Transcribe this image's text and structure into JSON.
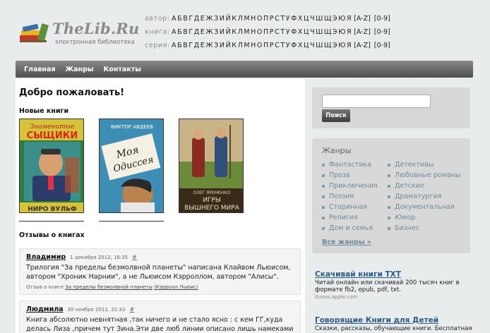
{
  "site": {
    "title": "TheLib.Ru",
    "subtitle": "электронная библиотека"
  },
  "alphabet": {
    "rows": [
      {
        "label": "автор:"
      },
      {
        "label": "книга:"
      },
      {
        "label": "серия:"
      }
    ],
    "letters": [
      "А",
      "Б",
      "В",
      "Г",
      "Д",
      "Е",
      "Ж",
      "З",
      "И",
      "Й",
      "К",
      "Л",
      "М",
      "Н",
      "О",
      "П",
      "Р",
      "С",
      "Т",
      "У",
      "Ф",
      "Х",
      "Ц",
      "Ч",
      "Ш",
      "Щ",
      "Э",
      "Ю",
      "Я"
    ],
    "latin": "[A-Z]",
    "digits": "[0-9]"
  },
  "nav": {
    "items": [
      "Главная",
      "Жанры",
      "Контакты"
    ]
  },
  "main": {
    "welcome": "Добро пожаловать!",
    "new_books_heading": "Новые книги",
    "books": [
      {
        "title": "ЗНАМЕНИТЫЕ СЫЩИКИ",
        "author": "НИРО ВУЛЬФ"
      },
      {
        "title": "Моя Одиссея",
        "author": "ВИКТОР АВДЕЕВ"
      },
      {
        "title": "ИГРЫ ВЫШНЕГО МИРА",
        "author": "ОЛЕГ ЯРЕМЕНКО"
      }
    ],
    "reviews_heading": "Отзывы о книгах",
    "reviews": [
      {
        "author": "Владимир",
        "date": "1 декабря 2012, 16:35",
        "hash": "#",
        "text": "Трилогия \"За пределы безмолвной планеты\" написана Клайвом Льюисом, автором \"Хроник Нарнии\", а не Льюисом Кэрроллом, автором \"Алисы\".",
        "meta_prefix": "Отзыв о книге",
        "book_link": "За пределы безмолвной планеты",
        "book_author": "(Кэрролл Льюис)"
      },
      {
        "author": "Людмила",
        "date": "30 ноября 2012, 22:33",
        "hash": "#",
        "text": "Книга абсолютно невнятная ,так ничего и не стало ясно : с кем ГГ,куда делась Лиза ,причем тут Зина.Эти две люб линии описано лишь намеками"
      }
    ]
  },
  "sidebar": {
    "search_button": "Поиск",
    "genres_title": "Жанры",
    "genres_left": [
      "Фантастика",
      "Проза",
      "Приключения",
      "Поэзия",
      "Старинная",
      "Религия",
      "Дом и семья"
    ],
    "genres_right": [
      "Детективы",
      "Любовные романы",
      "Детские",
      "Драматургия",
      "Документальная",
      "Юмор",
      "Бизнес"
    ],
    "all_genres": "Все жанры »",
    "ads": [
      {
        "title": "Скачивай книги ТХТ",
        "text": "Читай онлайн или скачивай 200 тысяч книг в формате fb2, epub, pdf, txt.",
        "url": "itunes.apple.com"
      },
      {
        "title": "Говорящие Книги для Детей",
        "text": "Сказки, рассказы, обучающие книги. Бесплатная доставка"
      }
    ]
  },
  "colors": {
    "link_muted": "#6f8b97",
    "ad_link": "#2a5b88",
    "panel_bg": "#d8d8d8",
    "nav_top": "#8a8a8a",
    "nav_bottom": "#4e4e4e"
  }
}
